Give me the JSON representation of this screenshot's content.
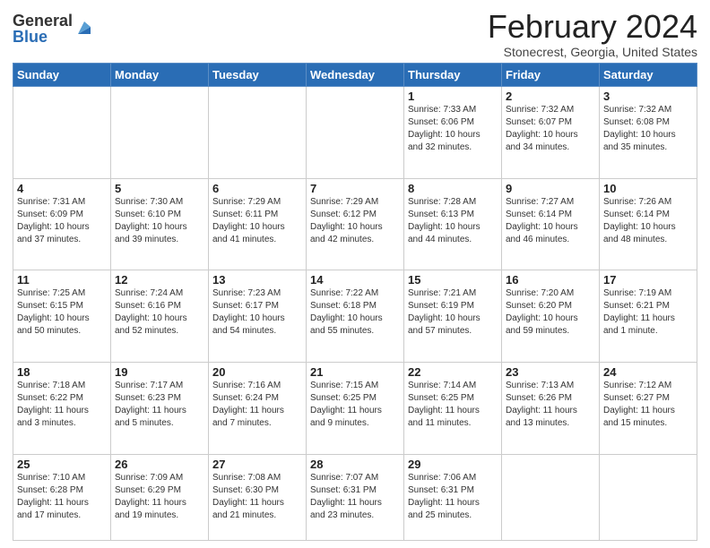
{
  "logo": {
    "general": "General",
    "blue": "Blue"
  },
  "title": "February 2024",
  "location": "Stonecrest, Georgia, United States",
  "days_of_week": [
    "Sunday",
    "Monday",
    "Tuesday",
    "Wednesday",
    "Thursday",
    "Friday",
    "Saturday"
  ],
  "weeks": [
    [
      {
        "day": "",
        "info": "",
        "empty": true
      },
      {
        "day": "",
        "info": "",
        "empty": true
      },
      {
        "day": "",
        "info": "",
        "empty": true
      },
      {
        "day": "",
        "info": "",
        "empty": true
      },
      {
        "day": "1",
        "info": "Sunrise: 7:33 AM\nSunset: 6:06 PM\nDaylight: 10 hours\nand 32 minutes.",
        "empty": false
      },
      {
        "day": "2",
        "info": "Sunrise: 7:32 AM\nSunset: 6:07 PM\nDaylight: 10 hours\nand 34 minutes.",
        "empty": false
      },
      {
        "day": "3",
        "info": "Sunrise: 7:32 AM\nSunset: 6:08 PM\nDaylight: 10 hours\nand 35 minutes.",
        "empty": false
      }
    ],
    [
      {
        "day": "4",
        "info": "Sunrise: 7:31 AM\nSunset: 6:09 PM\nDaylight: 10 hours\nand 37 minutes.",
        "empty": false
      },
      {
        "day": "5",
        "info": "Sunrise: 7:30 AM\nSunset: 6:10 PM\nDaylight: 10 hours\nand 39 minutes.",
        "empty": false
      },
      {
        "day": "6",
        "info": "Sunrise: 7:29 AM\nSunset: 6:11 PM\nDaylight: 10 hours\nand 41 minutes.",
        "empty": false
      },
      {
        "day": "7",
        "info": "Sunrise: 7:29 AM\nSunset: 6:12 PM\nDaylight: 10 hours\nand 42 minutes.",
        "empty": false
      },
      {
        "day": "8",
        "info": "Sunrise: 7:28 AM\nSunset: 6:13 PM\nDaylight: 10 hours\nand 44 minutes.",
        "empty": false
      },
      {
        "day": "9",
        "info": "Sunrise: 7:27 AM\nSunset: 6:14 PM\nDaylight: 10 hours\nand 46 minutes.",
        "empty": false
      },
      {
        "day": "10",
        "info": "Sunrise: 7:26 AM\nSunset: 6:14 PM\nDaylight: 10 hours\nand 48 minutes.",
        "empty": false
      }
    ],
    [
      {
        "day": "11",
        "info": "Sunrise: 7:25 AM\nSunset: 6:15 PM\nDaylight: 10 hours\nand 50 minutes.",
        "empty": false
      },
      {
        "day": "12",
        "info": "Sunrise: 7:24 AM\nSunset: 6:16 PM\nDaylight: 10 hours\nand 52 minutes.",
        "empty": false
      },
      {
        "day": "13",
        "info": "Sunrise: 7:23 AM\nSunset: 6:17 PM\nDaylight: 10 hours\nand 54 minutes.",
        "empty": false
      },
      {
        "day": "14",
        "info": "Sunrise: 7:22 AM\nSunset: 6:18 PM\nDaylight: 10 hours\nand 55 minutes.",
        "empty": false
      },
      {
        "day": "15",
        "info": "Sunrise: 7:21 AM\nSunset: 6:19 PM\nDaylight: 10 hours\nand 57 minutes.",
        "empty": false
      },
      {
        "day": "16",
        "info": "Sunrise: 7:20 AM\nSunset: 6:20 PM\nDaylight: 10 hours\nand 59 minutes.",
        "empty": false
      },
      {
        "day": "17",
        "info": "Sunrise: 7:19 AM\nSunset: 6:21 PM\nDaylight: 11 hours\nand 1 minute.",
        "empty": false
      }
    ],
    [
      {
        "day": "18",
        "info": "Sunrise: 7:18 AM\nSunset: 6:22 PM\nDaylight: 11 hours\nand 3 minutes.",
        "empty": false
      },
      {
        "day": "19",
        "info": "Sunrise: 7:17 AM\nSunset: 6:23 PM\nDaylight: 11 hours\nand 5 minutes.",
        "empty": false
      },
      {
        "day": "20",
        "info": "Sunrise: 7:16 AM\nSunset: 6:24 PM\nDaylight: 11 hours\nand 7 minutes.",
        "empty": false
      },
      {
        "day": "21",
        "info": "Sunrise: 7:15 AM\nSunset: 6:25 PM\nDaylight: 11 hours\nand 9 minutes.",
        "empty": false
      },
      {
        "day": "22",
        "info": "Sunrise: 7:14 AM\nSunset: 6:25 PM\nDaylight: 11 hours\nand 11 minutes.",
        "empty": false
      },
      {
        "day": "23",
        "info": "Sunrise: 7:13 AM\nSunset: 6:26 PM\nDaylight: 11 hours\nand 13 minutes.",
        "empty": false
      },
      {
        "day": "24",
        "info": "Sunrise: 7:12 AM\nSunset: 6:27 PM\nDaylight: 11 hours\nand 15 minutes.",
        "empty": false
      }
    ],
    [
      {
        "day": "25",
        "info": "Sunrise: 7:10 AM\nSunset: 6:28 PM\nDaylight: 11 hours\nand 17 minutes.",
        "empty": false
      },
      {
        "day": "26",
        "info": "Sunrise: 7:09 AM\nSunset: 6:29 PM\nDaylight: 11 hours\nand 19 minutes.",
        "empty": false
      },
      {
        "day": "27",
        "info": "Sunrise: 7:08 AM\nSunset: 6:30 PM\nDaylight: 11 hours\nand 21 minutes.",
        "empty": false
      },
      {
        "day": "28",
        "info": "Sunrise: 7:07 AM\nSunset: 6:31 PM\nDaylight: 11 hours\nand 23 minutes.",
        "empty": false
      },
      {
        "day": "29",
        "info": "Sunrise: 7:06 AM\nSunset: 6:31 PM\nDaylight: 11 hours\nand 25 minutes.",
        "empty": false
      },
      {
        "day": "",
        "info": "",
        "empty": true
      },
      {
        "day": "",
        "info": "",
        "empty": true
      }
    ]
  ]
}
